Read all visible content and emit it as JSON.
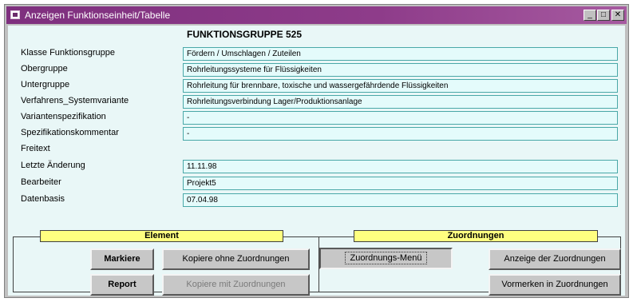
{
  "window": {
    "title": "Anzeigen Funktionseinheit/Tabelle",
    "minimize": "_",
    "maximize": "□",
    "close": "✕"
  },
  "heading": "FUNKTIONSGRUPPE 525",
  "labels": {
    "klasse": "Klasse Funktionsgruppe",
    "obergruppe": "Obergruppe",
    "untergruppe": "Untergruppe",
    "verfahren": "Verfahrens_Systemvariante",
    "variantenspez": "Variantenspezifikation",
    "spezkommentar": "Spezifikationskommentar",
    "freitext": "Freitext",
    "letzte_aenderung": "Letzte Änderung",
    "bearbeiter": "Bearbeiter",
    "datenbasis": "Datenbasis"
  },
  "values": {
    "klasse": "Fördern / Umschlagen / Zuteilen",
    "obergruppe": "Rohrleitungssysteme für Flüssigkeiten",
    "untergruppe": "Rohrleitung für brennbare, toxische und wassergefährdende Flüssigkeiten",
    "verfahren": "Rohrleitungsverbindung Lager/Produktionsanlage",
    "variantenspez": "-",
    "spezkommentar": "-",
    "letzte_aenderung": "11.11.98",
    "bearbeiter": "Projekt5",
    "datenbasis": "07.04.98"
  },
  "element_panel": {
    "title": "Element",
    "markiere": "Markiere",
    "kopiere_ohne": "Kopiere ohne Zuordnungen",
    "report": "Report",
    "kopiere_mit": "Kopiere mit Zuordnungen"
  },
  "zuordnungen_panel": {
    "title": "Zuordnungen",
    "menu": "Zuordnungs-Menü",
    "anzeige": "Anzeige der Zuordnungen",
    "vormerken": "Vormerken in Zuordnungen"
  }
}
